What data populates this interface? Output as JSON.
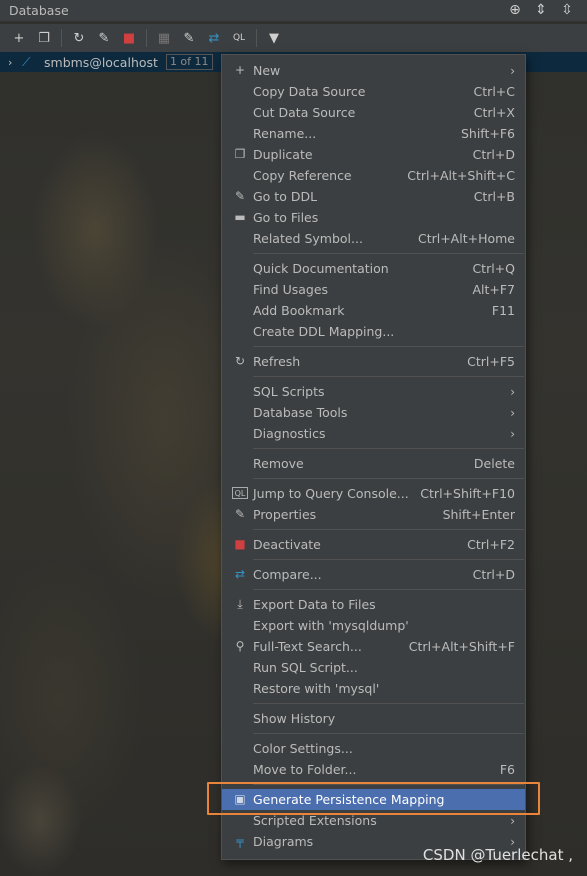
{
  "window": {
    "title": "Database"
  },
  "tree": {
    "label": "smbms@localhost",
    "badge": "1 of 11"
  },
  "menu": {
    "items": [
      {
        "label": "New",
        "shortcut": "",
        "submenu": true,
        "icon": "plus-icon"
      },
      {
        "label": "Copy Data Source",
        "shortcut": "Ctrl+C"
      },
      {
        "label": "Cut Data Source",
        "shortcut": "Ctrl+X"
      },
      {
        "label": "Rename...",
        "shortcut": "Shift+F6"
      },
      {
        "label": "Duplicate",
        "shortcut": "Ctrl+D",
        "icon": "duplicate-icon"
      },
      {
        "label": "Copy Reference",
        "shortcut": "Ctrl+Alt+Shift+C"
      },
      {
        "label": "Go to DDL",
        "shortcut": "Ctrl+B",
        "icon": "pencil-icon"
      },
      {
        "label": "Go to Files",
        "shortcut": "",
        "icon": "folder-icon"
      },
      {
        "label": "Related Symbol...",
        "shortcut": "Ctrl+Alt+Home"
      },
      {
        "label": "Quick Documentation",
        "shortcut": "Ctrl+Q"
      },
      {
        "label": "Find Usages",
        "shortcut": "Alt+F7"
      },
      {
        "label": "Add Bookmark",
        "shortcut": "F11"
      },
      {
        "label": "Create DDL Mapping...",
        "shortcut": ""
      },
      {
        "label": "Refresh",
        "shortcut": "Ctrl+F5",
        "icon": "refresh-icon"
      },
      {
        "label": "SQL Scripts",
        "shortcut": "",
        "submenu": true
      },
      {
        "label": "Database Tools",
        "shortcut": "",
        "submenu": true
      },
      {
        "label": "Diagnostics",
        "shortcut": "",
        "submenu": true
      },
      {
        "label": "Remove",
        "shortcut": "Delete"
      },
      {
        "label": "Jump to Query Console...",
        "shortcut": "Ctrl+Shift+F10",
        "icon": "console-icon"
      },
      {
        "label": "Properties",
        "shortcut": "Shift+Enter",
        "icon": "properties-icon"
      },
      {
        "label": "Deactivate",
        "shortcut": "Ctrl+F2",
        "icon": "deactivate-icon"
      },
      {
        "label": "Compare...",
        "shortcut": "Ctrl+D",
        "icon": "compare-icon"
      },
      {
        "label": "Export Data to Files",
        "shortcut": "",
        "icon": "export-icon"
      },
      {
        "label": "Export with 'mysqldump'",
        "shortcut": ""
      },
      {
        "label": "Full-Text Search...",
        "shortcut": "Ctrl+Alt+Shift+F",
        "icon": "search-icon"
      },
      {
        "label": "Run SQL Script...",
        "shortcut": ""
      },
      {
        "label": "Restore with 'mysql'",
        "shortcut": ""
      },
      {
        "label": "Show History",
        "shortcut": ""
      },
      {
        "label": "Color Settings...",
        "shortcut": ""
      },
      {
        "label": "Move to Folder...",
        "shortcut": "F6"
      },
      {
        "label": "Generate Persistence Mapping",
        "shortcut": "",
        "icon": "persistence-icon"
      },
      {
        "label": "Scripted Extensions",
        "shortcut": "",
        "submenu": true
      },
      {
        "label": "Diagrams",
        "shortcut": "",
        "submenu": true,
        "icon": "diagram-icon"
      }
    ]
  },
  "watermark": "CSDN @Tuerlechat ,",
  "colors": {
    "highlight": "#4b6eaf",
    "menu_bg": "#3c3f41",
    "focus_box": "#e8853a"
  }
}
